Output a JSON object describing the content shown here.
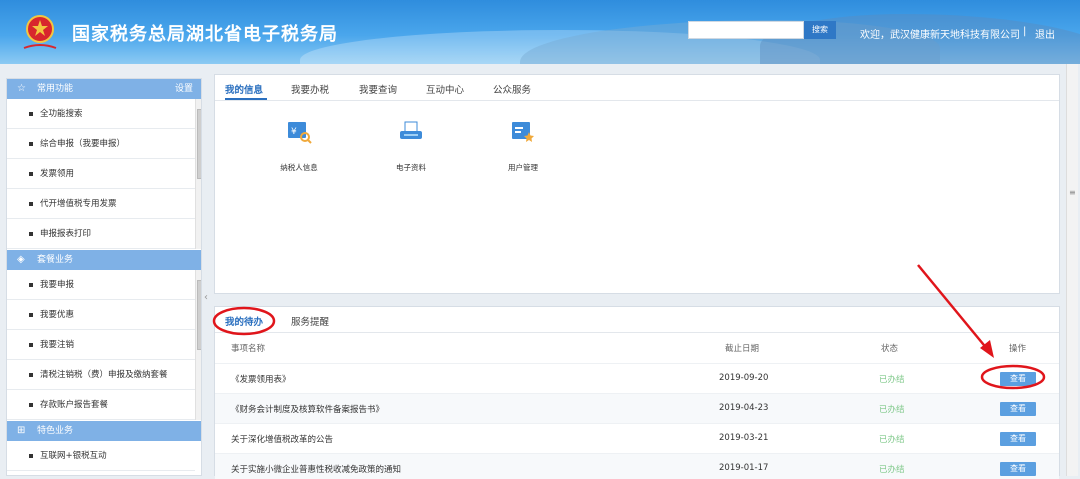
{
  "header": {
    "title": "国家税务总局湖北省电子税务局",
    "search_button": "搜索",
    "welcome": "欢迎，武汉健康新天地科技有限公司",
    "separator": "|",
    "logout": "退出"
  },
  "sidebar": {
    "sections": [
      {
        "title": "常用功能",
        "settings": "设置",
        "items": [
          "全功能搜索",
          "综合申报（我要申报）",
          "发票领用",
          "代开增值税专用发票",
          "申报报表打印"
        ]
      },
      {
        "title": "套餐业务",
        "items": [
          "我要申报",
          "我要优惠",
          "我要注销",
          "清税注销税（费）申报及缴纳套餐",
          "存款账户报告套餐"
        ]
      },
      {
        "title": "特色业务",
        "items": [
          "互联网+银税互动"
        ]
      }
    ]
  },
  "top_panel": {
    "tabs": [
      "我的信息",
      "我要办税",
      "我要查询",
      "互动中心",
      "公众服务"
    ],
    "tiles": [
      {
        "label": "纳税人信息",
        "icon": "taxpayer-info-icon"
      },
      {
        "label": "电子资料",
        "icon": "electronic-data-icon"
      },
      {
        "label": "用户管理",
        "icon": "user-management-icon"
      }
    ]
  },
  "todo_panel": {
    "tabs": [
      "我的待办",
      "服务提醒"
    ],
    "columns": [
      "事项名称",
      "截止日期",
      "状态",
      "操作"
    ],
    "rows": [
      {
        "name": "《发票领用表》",
        "deadline": "2019-09-20",
        "status": "已办结",
        "action": "查看"
      },
      {
        "name": "《财务会计制度及核算软件备案报告书》",
        "deadline": "2019-04-23",
        "status": "已办结",
        "action": "查看"
      },
      {
        "name": "关于深化增值税改革的公告",
        "deadline": "2019-03-21",
        "status": "已办结",
        "action": "查看"
      },
      {
        "name": "关于实施小微企业普惠性税收减免政策的通知",
        "deadline": "2019-01-17",
        "status": "已办结",
        "action": "查看"
      }
    ]
  },
  "colors": {
    "header_blue": "#2f8ddd",
    "section_head": "#7fb1e6",
    "accent": "#2a6fbf",
    "button": "#5b9fe0",
    "status_done": "#7fc88a",
    "annotation_red": "#e0151b"
  }
}
